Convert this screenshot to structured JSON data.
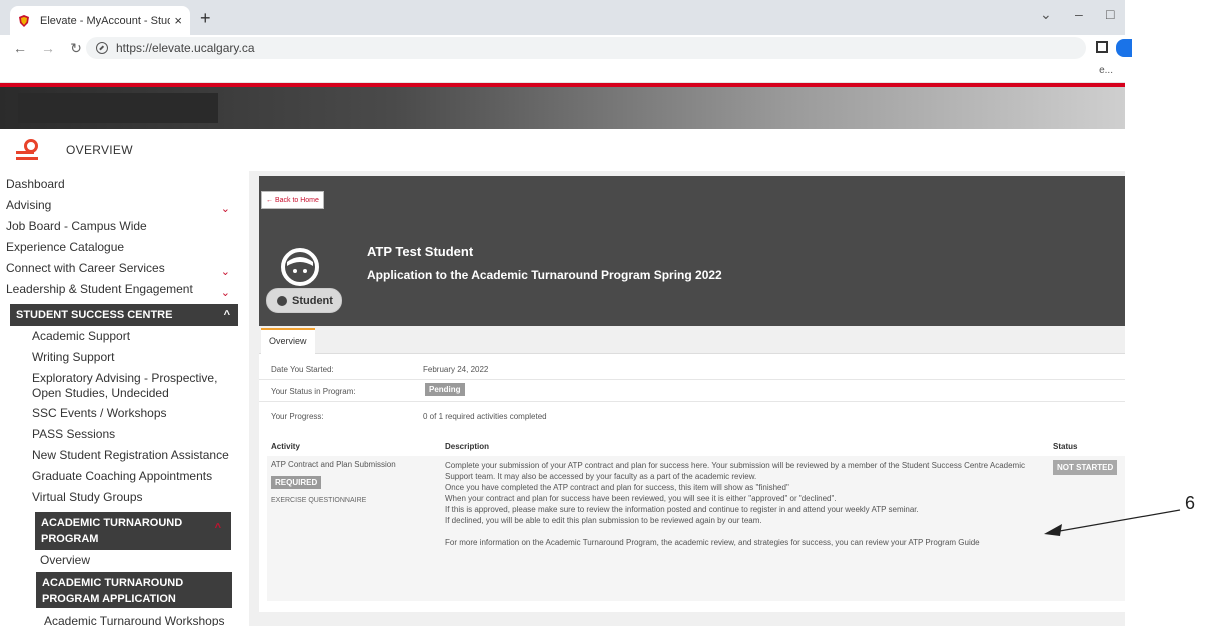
{
  "browser": {
    "tab_title": "Elevate - MyAccount - Student S",
    "tab_close": "×",
    "new_tab": "+",
    "url": "https://elevate.ucalgary.ca",
    "bookmark_overflow": "e...",
    "win_min": "–",
    "win_max": "□",
    "win_down": "⌄"
  },
  "header": {
    "section": "OVERVIEW"
  },
  "sidebar": {
    "items": [
      {
        "label": "Dashboard"
      },
      {
        "label": "Advising",
        "chevron": "⌄"
      },
      {
        "label": "Job Board - Campus Wide"
      },
      {
        "label": "Experience Catalogue"
      },
      {
        "label": "Connect with Career Services",
        "chevron": "⌄"
      },
      {
        "label": "Leadership & Student Engagement",
        "chevron": "⌄"
      }
    ],
    "active_section": "STUDENT SUCCESS CENTRE",
    "active_chevron": "^",
    "sub_items": [
      "Academic Support",
      "Writing Support",
      "Exploratory Advising - Prospective, Open Studies, Undecided",
      "SSC Events / Workshops",
      "PASS Sessions",
      "New Student Registration Assistance",
      "Graduate Coaching Appointments",
      "Virtual Study Groups"
    ],
    "atp_section": "ACADEMIC TURNAROUND PROGRAM",
    "atp_chevron": "^",
    "atp_overview": "Overview",
    "atp_application": "ACADEMIC TURNAROUND PROGRAM APPLICATION",
    "atp_workshops": "Academic Turnaround Workshops"
  },
  "main": {
    "back_label": "← Back to Home",
    "student_name": "ATP Test Student",
    "program_title": "Application to the Academic Turnaround Program Spring 2022",
    "role": "Student",
    "tab_overview": "Overview",
    "date_label": "Date You Started:",
    "date_value": "February 24, 2022",
    "status_label": "Your Status in Program:",
    "status_value": "Pending",
    "progress_label": "Your Progress:",
    "progress_value": "0 of 1 required activities completed",
    "table": {
      "col_activity": "Activity",
      "col_description": "Description",
      "col_status": "Status",
      "row": {
        "activity": "ATP Contract and Plan Submission",
        "required": "REQUIRED",
        "type": "EXERCISE QUESTIONNAIRE",
        "desc1": "Complete your submission of your ATP contract and plan for success here. Your submission will be reviewed by a member of the Student Success Centre Academic Support team. It may also be accessed by your faculty as a part of the academic review.",
        "desc2": "Once you have completed the ATP contract and plan for success, this item will show as \"finished\"",
        "desc3": "When your contract and plan for success have been reviewed, you will see it is either \"approved\" or \"declined\".",
        "desc4": "If this is approved, please make sure to review the information posted and continue to register in and attend your weekly ATP seminar.",
        "desc5": "If declined, you will be able to edit this plan submission to be reviewed again by our team.",
        "desc6": "For more information on the Academic Turnaround Program, the academic review, and strategies for success, you can review your ATP Program Guide",
        "status": "NOT STARTED"
      }
    }
  },
  "annotation": {
    "number": "6"
  },
  "colors": {
    "accent_red": "#c8102e",
    "dark_panel": "#4a4a4a",
    "badge_gray": "#9a9a9a"
  }
}
